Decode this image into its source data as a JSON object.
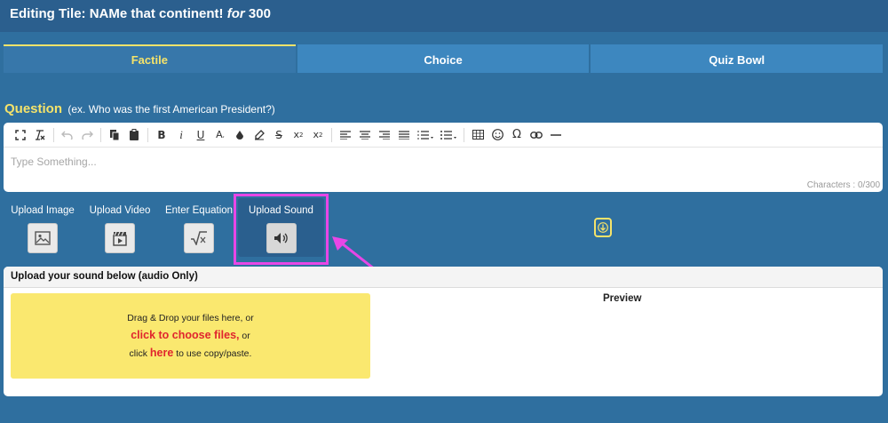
{
  "header": {
    "prefix": "Editing Tile: NAMe that continent!",
    "for_word": "for",
    "points": "300"
  },
  "tabs": [
    {
      "label": "Factile",
      "active": true
    },
    {
      "label": "Choice",
      "active": false
    },
    {
      "label": "Quiz Bowl",
      "active": false
    }
  ],
  "question": {
    "label": "Question",
    "hint": "(ex. Who was the first American President?)"
  },
  "editor": {
    "placeholder": "Type Something...",
    "char_count": "Characters : 0/300",
    "toolbar_icons": [
      "fullscreen-icon",
      "clear-format-icon",
      "undo-icon",
      "redo-icon",
      "copy-icon",
      "paste-icon",
      "bold-icon",
      "italic-icon",
      "underline-icon",
      "font-size-icon",
      "text-color-icon",
      "highlight-icon",
      "strikethrough-icon",
      "subscript-icon",
      "superscript-icon",
      "align-left-icon",
      "align-center-icon",
      "align-right-icon",
      "justify-icon",
      "ordered-list-icon",
      "unordered-list-icon",
      "table-icon",
      "emoji-icon",
      "omega-icon",
      "link-icon",
      "horizontal-rule-icon"
    ]
  },
  "media": {
    "upload_image": "Upload Image",
    "upload_video": "Upload Video",
    "enter_equation": "Enter Equation",
    "upload_sound": "Upload Sound"
  },
  "upload_panel": {
    "title": "Upload your sound below (audio Only)",
    "drop_line1": "Drag & Drop your files here, or",
    "choose_files": "click to choose files,",
    "or_word": "or",
    "click_word": "click",
    "here_word": "here",
    "copy_paste": "to use copy/paste.",
    "preview": "Preview"
  },
  "colors": {
    "background": "#2f6f9f",
    "accent_yellow": "#f5e36a",
    "highlight_magenta": "#e846e6",
    "link_red": "#e0252e"
  }
}
